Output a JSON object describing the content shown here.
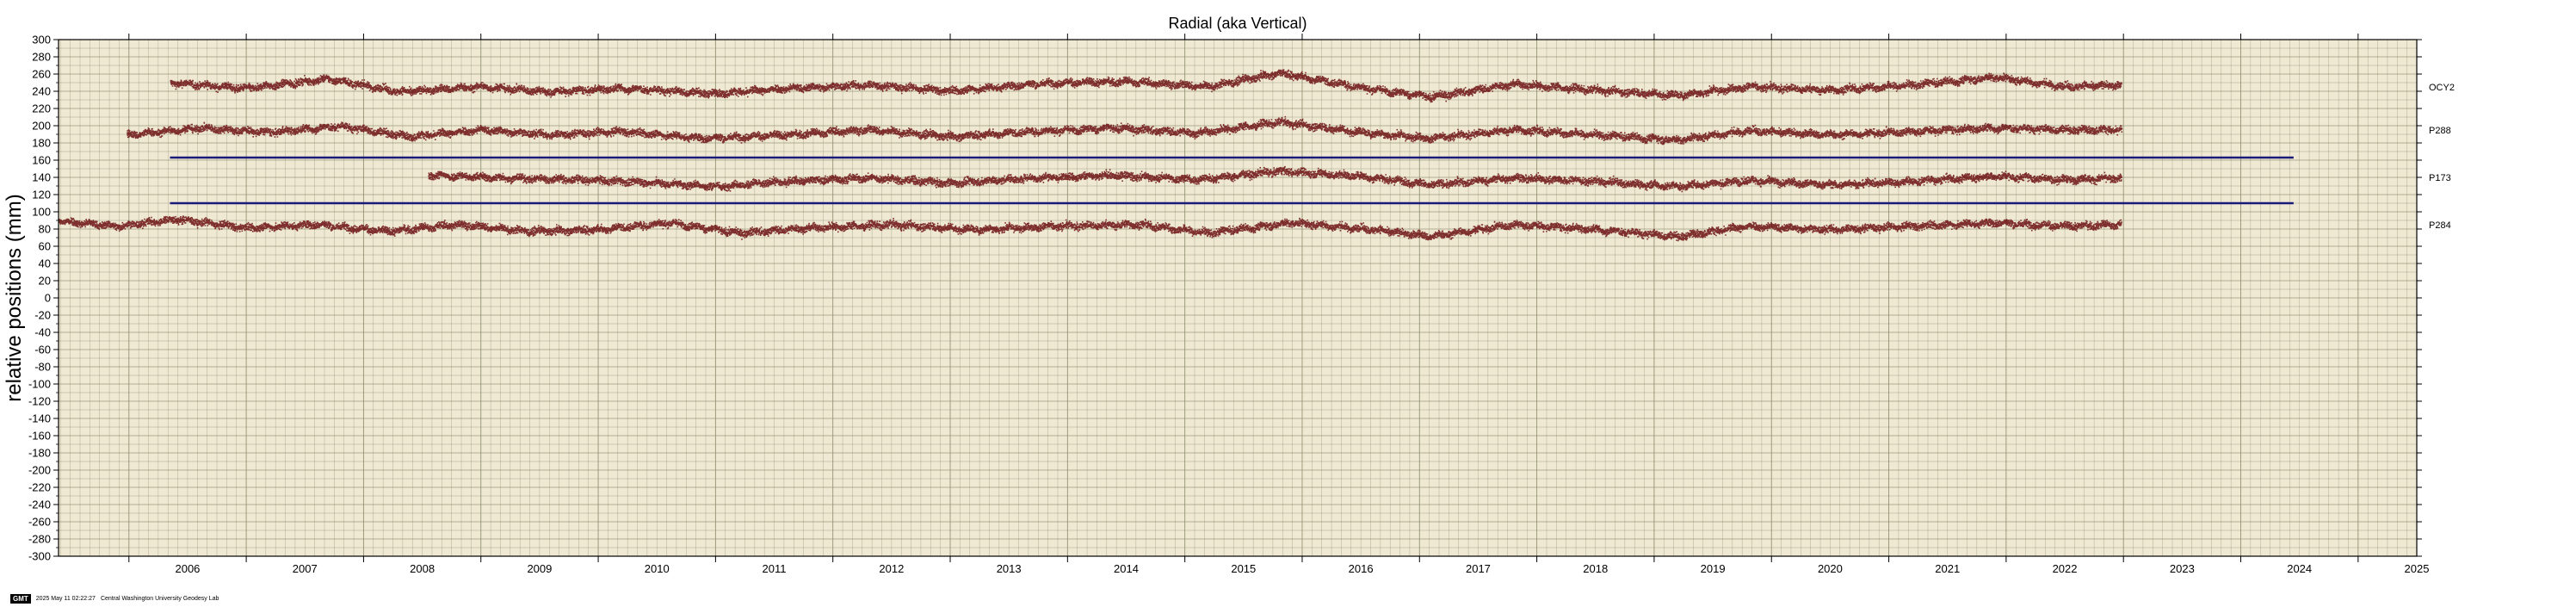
{
  "chart_data": {
    "type": "scatter",
    "title": "Radial (aka Vertical)",
    "ylabel": "relative positions (mm)",
    "xlabel": "",
    "xlim": [
      2005.4,
      2025.5
    ],
    "ylim": [
      -300,
      300
    ],
    "x_ticks": [
      2006,
      2007,
      2008,
      2009,
      2010,
      2011,
      2012,
      2013,
      2014,
      2015,
      2016,
      2017,
      2018,
      2019,
      2020,
      2021,
      2022,
      2023,
      2024,
      2025
    ],
    "y_ticks": [
      300,
      280,
      260,
      240,
      220,
      200,
      180,
      160,
      140,
      120,
      100,
      80,
      60,
      40,
      20,
      0,
      -20,
      -40,
      -60,
      -80,
      -100,
      -120,
      -140,
      -160,
      -180,
      -200,
      -220,
      -240,
      -260,
      -280,
      -300
    ],
    "grid": true,
    "colors": {
      "background": "#efe9d4",
      "grid": "#8a8a6a",
      "points": "#6b0f10",
      "reference_line": "#1a1a7a"
    },
    "series": [
      {
        "name": "OCY2",
        "offset": 245,
        "start": 2006.35,
        "end": 2022.98,
        "points": [
          [
            2006.4,
            250
          ],
          [
            2007.0,
            244
          ],
          [
            2007.7,
            255
          ],
          [
            2008.3,
            240
          ],
          [
            2009.0,
            246
          ],
          [
            2009.6,
            240
          ],
          [
            2010.2,
            244
          ],
          [
            2011.0,
            238
          ],
          [
            2011.6,
            244
          ],
          [
            2012.3,
            248
          ],
          [
            2013.0,
            241
          ],
          [
            2013.8,
            250
          ],
          [
            2014.5,
            252
          ],
          [
            2015.2,
            246
          ],
          [
            2015.8,
            262
          ],
          [
            2016.5,
            245
          ],
          [
            2017.1,
            234
          ],
          [
            2017.8,
            249
          ],
          [
            2018.5,
            242
          ],
          [
            2019.2,
            236
          ],
          [
            2019.8,
            246
          ],
          [
            2020.5,
            242
          ],
          [
            2021.2,
            248
          ],
          [
            2021.9,
            257
          ],
          [
            2022.5,
            246
          ],
          [
            2022.98,
            248
          ]
        ]
      },
      {
        "name": "P288",
        "offset": 195,
        "start": 2005.98,
        "end": 2022.98,
        "points": [
          [
            2006.0,
            190
          ],
          [
            2006.6,
            198
          ],
          [
            2007.2,
            193
          ],
          [
            2007.8,
            200
          ],
          [
            2008.4,
            188
          ],
          [
            2009.0,
            196
          ],
          [
            2009.6,
            190
          ],
          [
            2010.2,
            194
          ],
          [
            2010.9,
            186
          ],
          [
            2011.6,
            190
          ],
          [
            2012.3,
            196
          ],
          [
            2013.0,
            188
          ],
          [
            2013.7,
            194
          ],
          [
            2014.4,
            198
          ],
          [
            2015.1,
            192
          ],
          [
            2015.8,
            205
          ],
          [
            2016.5,
            193
          ],
          [
            2017.1,
            186
          ],
          [
            2017.8,
            196
          ],
          [
            2018.5,
            190
          ],
          [
            2019.2,
            184
          ],
          [
            2019.8,
            195
          ],
          [
            2020.5,
            190
          ],
          [
            2021.2,
            194
          ],
          [
            2021.9,
            198
          ],
          [
            2022.5,
            196
          ],
          [
            2022.98,
            196
          ]
        ]
      },
      {
        "name": "P173",
        "offset": 140,
        "start": 2008.55,
        "end": 2022.98,
        "points": [
          [
            2008.6,
            143
          ],
          [
            2009.2,
            140
          ],
          [
            2009.8,
            138
          ],
          [
            2010.4,
            135
          ],
          [
            2011.0,
            130
          ],
          [
            2011.6,
            136
          ],
          [
            2012.3,
            140
          ],
          [
            2013.0,
            134
          ],
          [
            2013.7,
            140
          ],
          [
            2014.4,
            143
          ],
          [
            2015.1,
            138
          ],
          [
            2015.8,
            148
          ],
          [
            2016.5,
            142
          ],
          [
            2017.1,
            132
          ],
          [
            2017.8,
            140
          ],
          [
            2018.5,
            136
          ],
          [
            2019.2,
            130
          ],
          [
            2019.8,
            137
          ],
          [
            2020.5,
            132
          ],
          [
            2021.2,
            136
          ],
          [
            2021.9,
            142
          ],
          [
            2022.5,
            138
          ],
          [
            2022.98,
            140
          ]
        ]
      },
      {
        "name": "P284",
        "offset": 85,
        "start": 2005.4,
        "end": 2022.98,
        "points": [
          [
            2005.4,
            90
          ],
          [
            2005.9,
            84
          ],
          [
            2006.4,
            92
          ],
          [
            2007.0,
            82
          ],
          [
            2007.6,
            86
          ],
          [
            2008.2,
            78
          ],
          [
            2008.8,
            86
          ],
          [
            2009.4,
            78
          ],
          [
            2010.0,
            80
          ],
          [
            2010.6,
            88
          ],
          [
            2011.2,
            76
          ],
          [
            2011.8,
            82
          ],
          [
            2012.5,
            86
          ],
          [
            2013.2,
            80
          ],
          [
            2013.9,
            84
          ],
          [
            2014.6,
            86
          ],
          [
            2015.2,
            76
          ],
          [
            2015.9,
            88
          ],
          [
            2016.6,
            80
          ],
          [
            2017.1,
            72
          ],
          [
            2017.8,
            86
          ],
          [
            2018.5,
            80
          ],
          [
            2019.2,
            72
          ],
          [
            2019.8,
            84
          ],
          [
            2020.5,
            80
          ],
          [
            2021.2,
            84
          ],
          [
            2021.9,
            88
          ],
          [
            2022.5,
            84
          ],
          [
            2022.98,
            86
          ]
        ]
      }
    ],
    "reference_lines": [
      {
        "y": 163,
        "x_start": 2006.35,
        "x_end": 2024.45
      },
      {
        "y": 110,
        "x_start": 2006.35,
        "x_end": 2024.45
      }
    ]
  },
  "footer": {
    "logo": "GMT",
    "timestamp": "2025 May 11 02:22:27",
    "credit": "Central Washington University Geodesy Lab"
  }
}
